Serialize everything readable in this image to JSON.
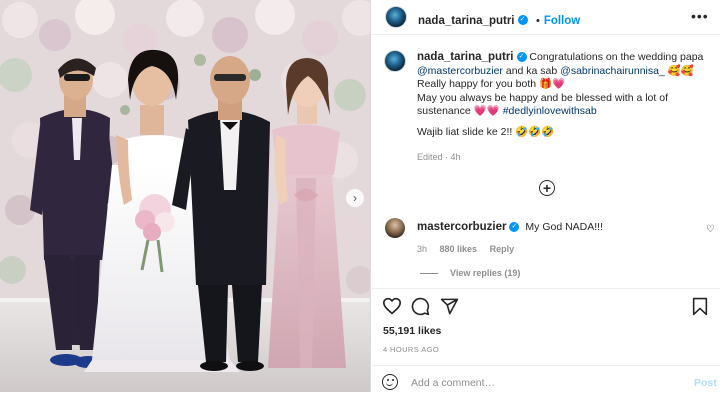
{
  "post": {
    "username": "nada_tarina_putri",
    "follow_label": "Follow",
    "more_label": "•••",
    "caption": {
      "line1_text": "Congratulations on the wedding papa",
      "line2_mention1": "@mastercorbuzier",
      "line2_mid": " and ka sab ",
      "line2_mention2": "@sabrinachairunnisa_",
      "line2_emoji": " 🥰🥰",
      "line3": "Really happy for you both 🎁💗",
      "line4": "May you always be happy and be blessed with a lot of",
      "line5_text": "sustenance 💗💗 ",
      "line5_tag": "#dedlyinlovewithsab",
      "line6": "Wajib liat slide ke 2!! 🤣🤣🤣"
    },
    "edited": "Edited · 4h",
    "likes": "55,191 likes",
    "time": "4 HOURS AGO"
  },
  "comment": {
    "username": "mastercorbuzier",
    "text": "My God NADA!!!",
    "age": "3h",
    "likes": "880 likes",
    "reply_label": "Reply",
    "view_replies": "View replies (19)"
  },
  "add_comment": {
    "placeholder": "Add a comment…",
    "post_label": "Post"
  },
  "icons": {
    "like": "heart-icon",
    "comment": "comment-icon",
    "share": "paper-plane-icon",
    "save": "bookmark-icon",
    "emoji": "emoji-icon",
    "add": "plus-circle-icon",
    "next": "chevron-right-icon"
  },
  "colors": {
    "accent": "#0095f6",
    "mention": "#00376b",
    "muted": "#8e8e8e"
  }
}
